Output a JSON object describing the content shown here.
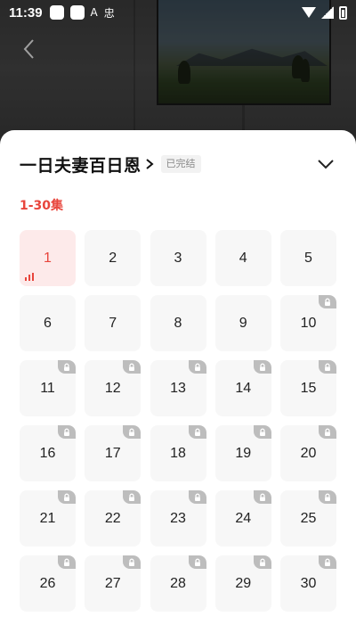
{
  "status_bar": {
    "time": "11:39",
    "glyph_a": "A",
    "glyph_b": "忠"
  },
  "sheet": {
    "title": "一日夫妻百日恩",
    "status_tag": "已完结",
    "range_tab": "1-30集",
    "accent_color": "#e8453c",
    "episodes": [
      {
        "label": "1",
        "state": "current"
      },
      {
        "label": "2",
        "state": "free"
      },
      {
        "label": "3",
        "state": "free"
      },
      {
        "label": "4",
        "state": "free"
      },
      {
        "label": "5",
        "state": "free"
      },
      {
        "label": "6",
        "state": "free"
      },
      {
        "label": "7",
        "state": "free"
      },
      {
        "label": "8",
        "state": "free"
      },
      {
        "label": "9",
        "state": "free"
      },
      {
        "label": "10",
        "state": "locked"
      },
      {
        "label": "11",
        "state": "locked"
      },
      {
        "label": "12",
        "state": "locked"
      },
      {
        "label": "13",
        "state": "locked"
      },
      {
        "label": "14",
        "state": "locked"
      },
      {
        "label": "15",
        "state": "locked"
      },
      {
        "label": "16",
        "state": "locked"
      },
      {
        "label": "17",
        "state": "locked"
      },
      {
        "label": "18",
        "state": "locked"
      },
      {
        "label": "19",
        "state": "locked"
      },
      {
        "label": "20",
        "state": "locked"
      },
      {
        "label": "21",
        "state": "locked"
      },
      {
        "label": "22",
        "state": "locked"
      },
      {
        "label": "23",
        "state": "locked"
      },
      {
        "label": "24",
        "state": "locked"
      },
      {
        "label": "25",
        "state": "locked"
      },
      {
        "label": "26",
        "state": "locked"
      },
      {
        "label": "27",
        "state": "locked"
      },
      {
        "label": "28",
        "state": "locked"
      },
      {
        "label": "29",
        "state": "locked"
      },
      {
        "label": "30",
        "state": "locked"
      }
    ]
  }
}
